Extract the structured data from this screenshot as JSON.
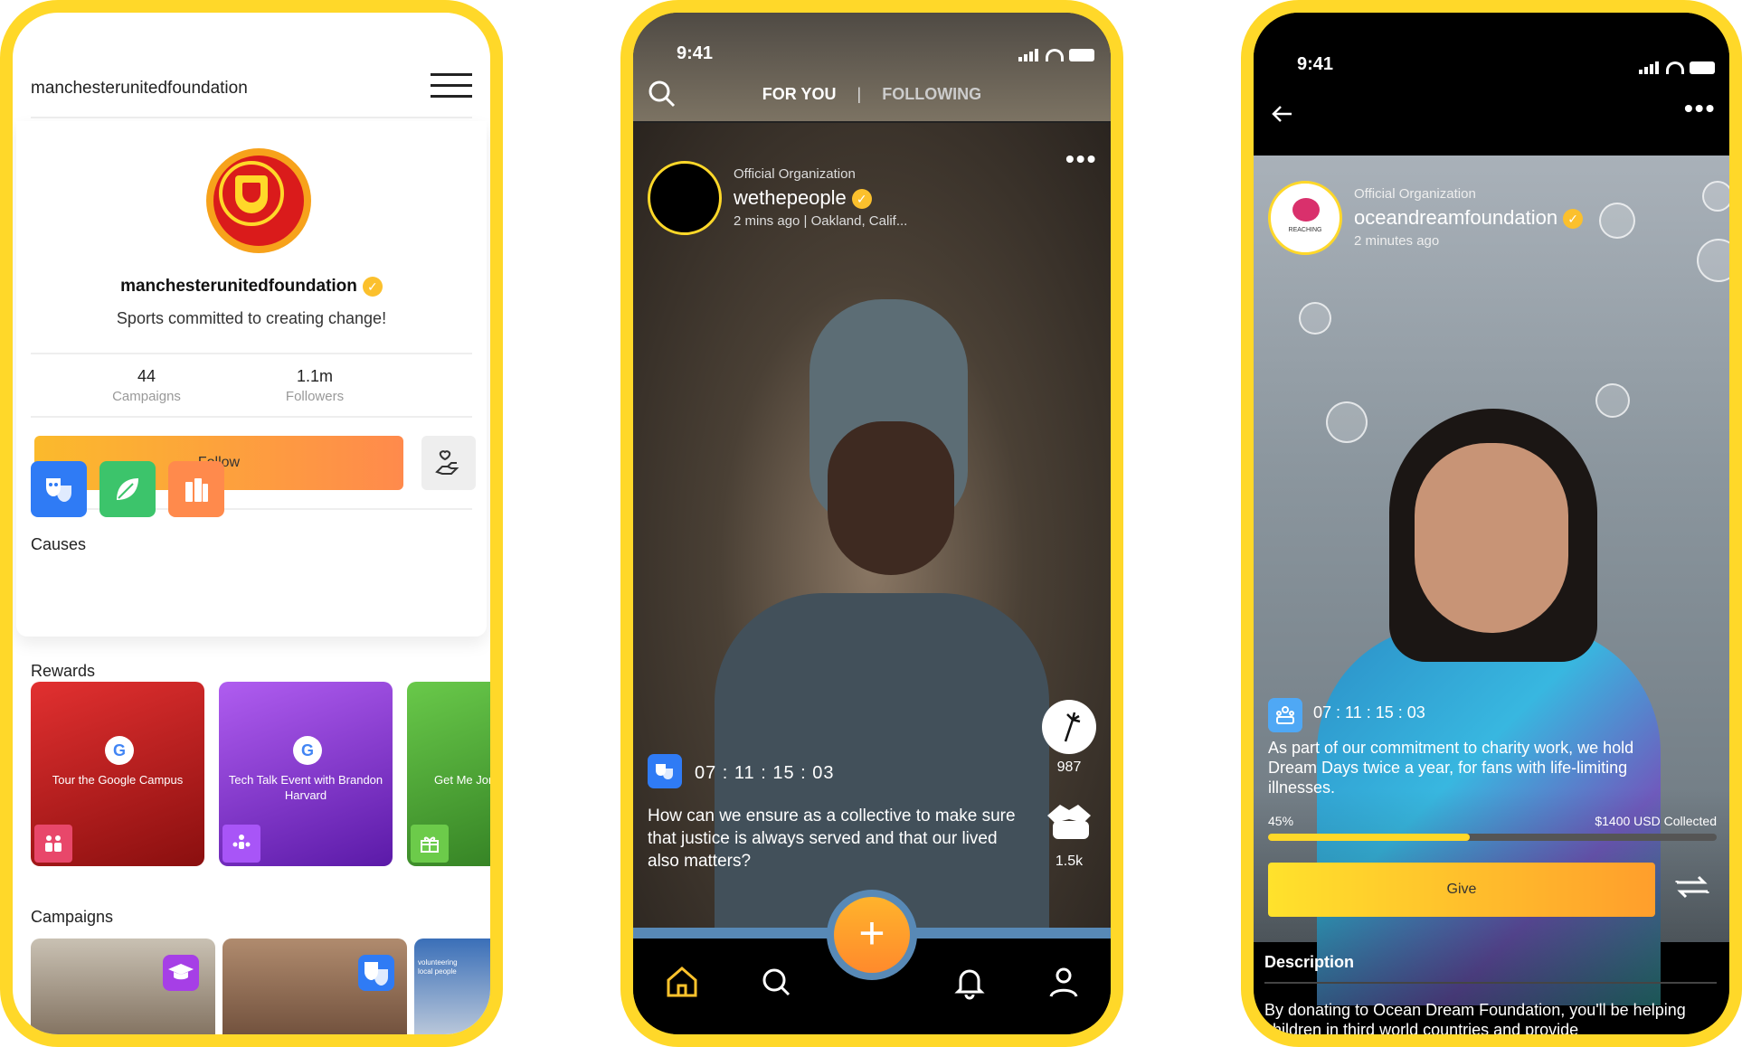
{
  "profile": {
    "handle": "manchesterunitedfoundation",
    "name": "manchesterunitedfoundation",
    "tagline": "Sports committed to creating change!",
    "campaigns_count": "44",
    "campaigns_label": "Campaigns",
    "followers_count": "1.1m",
    "followers_label": "Followers",
    "follow_label": "Follow",
    "causes_title": "Causes",
    "rewards_title": "Rewards",
    "campaigns_title": "Campaigns",
    "causes": [
      {
        "icon": "theater-masks-icon",
        "color": "#2F7BF5"
      },
      {
        "icon": "leaf-icon",
        "color": "#3CC46B"
      },
      {
        "icon": "books-icon",
        "color": "#FF8A4C"
      }
    ],
    "rewards": [
      {
        "title": "Tour the Google Campus",
        "color": "#C81F1F",
        "icon": "people-icon",
        "icon_color": "#E8476A"
      },
      {
        "title": "Tech Talk Event with Brandon Harvard",
        "color": "#8A2BE2",
        "icon": "group-icon",
        "icon_color": "#A855F7"
      },
      {
        "title": "Get Me Jonatha",
        "color": "#4FAE36",
        "icon": "gift-icon",
        "icon_color": "#6CCB4A"
      }
    ],
    "campaign_badges": [
      {
        "icon": "graduation-cap-icon",
        "color": "#A63FE6"
      },
      {
        "icon": "theater-masks-icon",
        "color": "#2F7BF5"
      }
    ],
    "campaign_thumb_text": "volunteering local people"
  },
  "feed": {
    "time": "9:41",
    "tab_for_you": "FOR YOU",
    "tab_separator": "|",
    "tab_following": "FOLLOWING",
    "org_label": "Official Organization",
    "author": "wethepeople",
    "meta": "2 mins ago | Oakland, Calif...",
    "more": "•••",
    "timer": "07 : 11 : 15 : 03",
    "caption": "How can we ensure as a collective to make sure that justice is always served and that our lived also matters?",
    "supports": "987",
    "shares": "1.5k",
    "fab_label": "+"
  },
  "detail": {
    "time": "9:41",
    "more": "•••",
    "org_label": "Official Organization",
    "author": "oceandreamfoundation",
    "meta": "2 minutes ago",
    "avatar_text": "REACHING",
    "timer": "07 : 11 : 15 : 03",
    "caption": "As part of our commitment to charity work, we hold Dream Days twice a year, for fans with life-limiting illnesses.",
    "progress_label": "45%",
    "progress_value": 45,
    "collected": "$1400 USD Collected",
    "give_label": "Give",
    "description_title": "Description",
    "description": "By donating to Ocean Dream Foundation, you'll be helping children in third world countries and provide"
  }
}
